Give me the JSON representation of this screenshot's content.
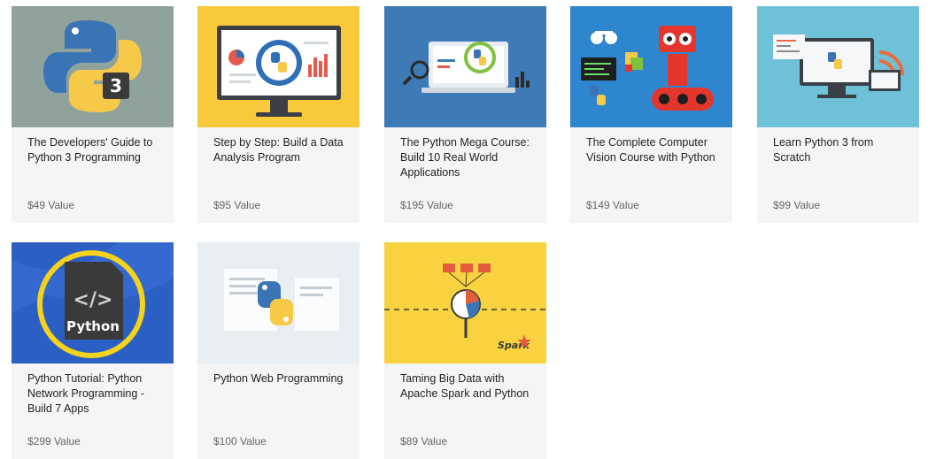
{
  "courses": [
    {
      "title": "The Developers' Guide to Python 3 Programming",
      "price": "$49 Value",
      "thumb_badge": "3",
      "colors": {
        "bg": "#8fa39c",
        "accent": "#f7c948"
      }
    },
    {
      "title": "Step by Step: Build a Data Analysis Program",
      "price": "$95 Value",
      "colors": {
        "bg": "#f8c93b",
        "accent": "#2f6fb5"
      }
    },
    {
      "title": "The Python Mega Course: Build 10 Real World Applications",
      "price": "$195 Value",
      "colors": {
        "bg": "#3e7bb6",
        "accent": "#f7c948"
      }
    },
    {
      "title": "The Complete Computer Vision Course with Python",
      "price": "$149 Value",
      "colors": {
        "bg": "#2e86cf",
        "accent": "#e5362d"
      }
    },
    {
      "title": "Learn Python 3 from Scratch",
      "price": "$99 Value",
      "colors": {
        "bg": "#6ec1d6",
        "accent": "#ec6a3c"
      }
    },
    {
      "title": "Python Tutorial: Python Network Programming - Build 7 Apps",
      "price": "$299 Value",
      "thumb_label": "Python",
      "thumb_code": "</>",
      "colors": {
        "bg": "#2b5fc4",
        "accent": "#f5d21b"
      }
    },
    {
      "title": "Python Web Programming",
      "price": "$100 Value",
      "colors": {
        "bg": "#e9eef2",
        "accent": "#3b74b4"
      }
    },
    {
      "title": "Taming Big Data with Apache Spark and Python",
      "price": "$89 Value",
      "thumb_label": "Spark",
      "colors": {
        "bg": "#f9d33f",
        "accent": "#e35d3d"
      }
    }
  ]
}
